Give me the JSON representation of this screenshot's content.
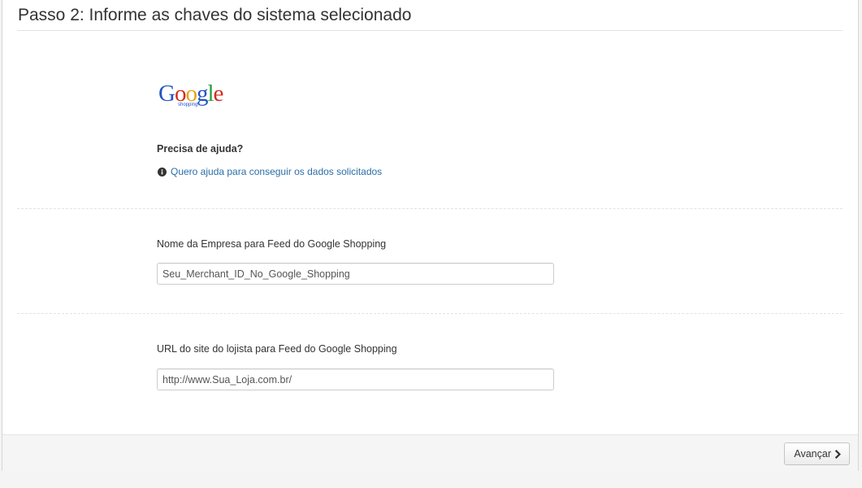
{
  "step": {
    "title": "Passo 2: Informe as chaves do sistema selecionado"
  },
  "logo": {
    "letters": [
      "G",
      "o",
      "o",
      "g",
      "l",
      "e"
    ],
    "sub": "shopping"
  },
  "help": {
    "heading": "Precisa de ajuda?",
    "link_label": "Quero ajuda para conseguir os dados solicitados",
    "icon": "info-circle-icon"
  },
  "fields": [
    {
      "label": "Nome da Empresa para Feed do Google Shopping",
      "value": "Seu_Merchant_ID_No_Google_Shopping"
    },
    {
      "label": "URL do site do lojista para Feed do Google Shopping",
      "value": "http://www.Sua_Loja.com.br/"
    }
  ],
  "footer": {
    "next_label": "Avançar",
    "next_icon": "chevron-right-icon"
  },
  "colors": {
    "link": "#2a6ea8",
    "google_blue": "#2453c4",
    "google_red": "#d52b1e",
    "google_yellow": "#e6a412",
    "google_green": "#27a140"
  }
}
